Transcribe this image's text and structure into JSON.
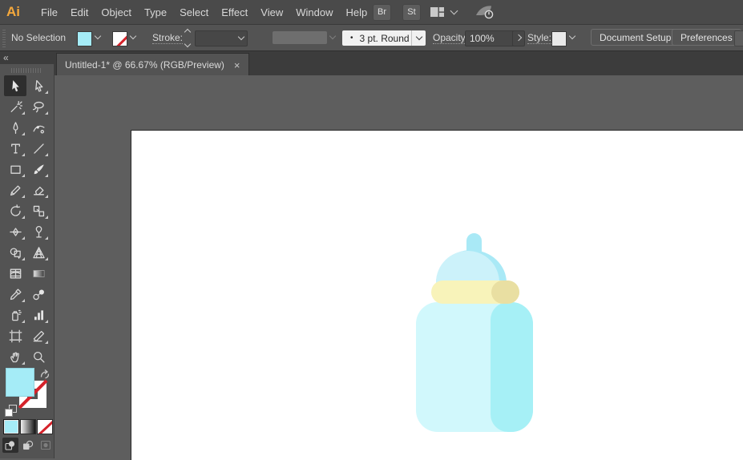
{
  "app": {
    "logo": "Ai",
    "menu": [
      "File",
      "Edit",
      "Object",
      "Type",
      "Select",
      "Effect",
      "View",
      "Window",
      "Help"
    ],
    "bridge_button": "Br",
    "stock_button": "St"
  },
  "control_bar": {
    "selection_status": "No Selection",
    "stroke_label": "Stroke:",
    "brush_preview_dot": "•",
    "brush_value": "3 pt. Round",
    "opacity_label": "Opacity:",
    "opacity_value": "100%",
    "style_label": "Style:",
    "document_setup_button": "Document Setup",
    "preferences_button": "Preferences"
  },
  "tab": {
    "title": "Untitled-1* @ 66.67% (RGB/Preview)",
    "close": "×"
  },
  "panel": {
    "collapse_glyph": "«"
  },
  "toolbar": {
    "tools": [
      {
        "name": "selection",
        "selected": true,
        "flyout": false
      },
      {
        "name": "direct-selection",
        "flyout": true
      },
      {
        "name": "magic-wand",
        "flyout": true
      },
      {
        "name": "lasso",
        "flyout": true
      },
      {
        "name": "pen",
        "flyout": true
      },
      {
        "name": "curvature",
        "flyout": false
      },
      {
        "name": "type",
        "flyout": true
      },
      {
        "name": "line-segment",
        "flyout": true
      },
      {
        "name": "rectangle",
        "flyout": true
      },
      {
        "name": "paintbrush",
        "flyout": true
      },
      {
        "name": "pencil",
        "flyout": true
      },
      {
        "name": "eraser",
        "flyout": true
      },
      {
        "name": "rotate",
        "flyout": true
      },
      {
        "name": "scale",
        "flyout": true
      },
      {
        "name": "width",
        "flyout": true
      },
      {
        "name": "free-transform",
        "flyout": true
      },
      {
        "name": "shape-builder",
        "flyout": true
      },
      {
        "name": "perspective-grid",
        "flyout": true
      },
      {
        "name": "mesh",
        "flyout": false
      },
      {
        "name": "gradient",
        "flyout": false
      },
      {
        "name": "eyedropper",
        "flyout": true
      },
      {
        "name": "blend",
        "flyout": false
      },
      {
        "name": "symbol-sprayer",
        "flyout": true
      },
      {
        "name": "column-graph",
        "flyout": true
      },
      {
        "name": "artboard",
        "flyout": false
      },
      {
        "name": "slice",
        "flyout": true
      },
      {
        "name": "hand",
        "flyout": true
      },
      {
        "name": "zoom",
        "flyout": false
      }
    ]
  },
  "theme": {
    "titlebar_bg": "#4a4a4a",
    "controlbar_bg": "#535353",
    "tabbar_bg": "#3c3c3c",
    "panel_bg": "#535353",
    "pasteboard_bg": "#5e5e5e",
    "artboard_bg": "#ffffff",
    "fill_color": "#a5ecf7",
    "logo_color": "#f4a83c",
    "none_slash_red": "#d5222a"
  },
  "artwork": {
    "subject": "baby-bottle",
    "colors": {
      "body_light": "#d1f8fc",
      "body_shade": "#a6f0f6",
      "cap_light": "#f8f3ba",
      "cap_shade": "#e9dfa2",
      "nipple_light": "#ccf2fa",
      "nipple_shade": "#a9e9f6"
    }
  }
}
